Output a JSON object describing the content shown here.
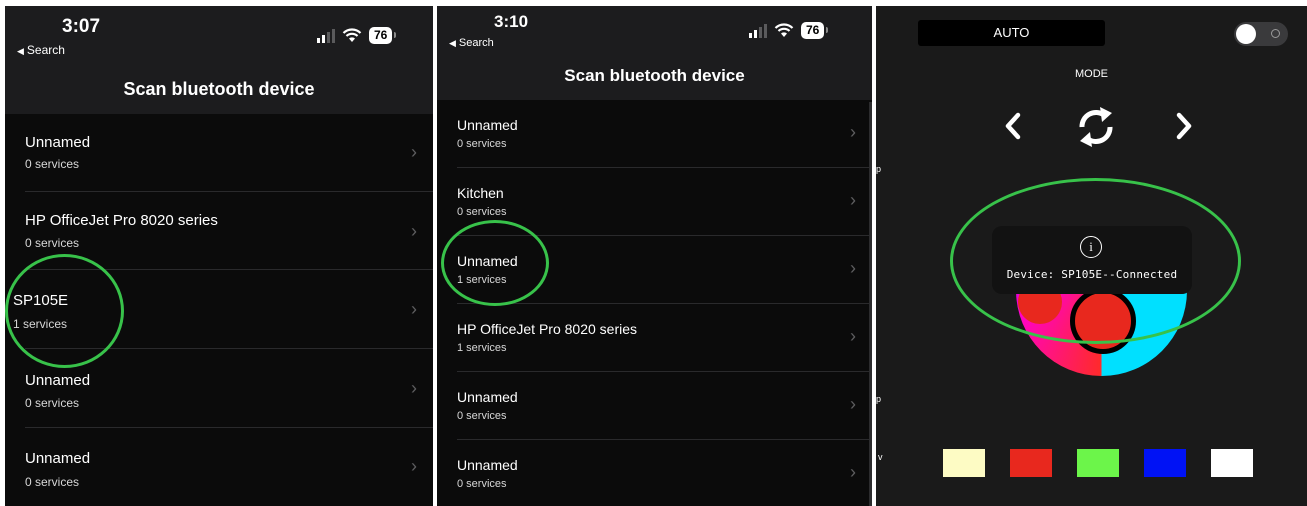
{
  "panel1": {
    "status": {
      "time": "3:07",
      "back": "Search",
      "battery": "76"
    },
    "title": "Scan bluetooth device",
    "devices": [
      {
        "name": "Unnamed",
        "services": "0 services"
      },
      {
        "name": "HP OfficeJet Pro 8020 series",
        "services": "0 services"
      },
      {
        "name": "SP105E",
        "services": "1 services"
      },
      {
        "name": "Unnamed",
        "services": "0 services"
      },
      {
        "name": "Unnamed",
        "services": "0 services"
      }
    ]
  },
  "panel2": {
    "status": {
      "time": "3:10",
      "back": "Search",
      "battery": "76"
    },
    "title": "Scan bluetooth device",
    "devices": [
      {
        "name": "Unnamed",
        "services": "0 services"
      },
      {
        "name": "Kitchen",
        "services": "0 services"
      },
      {
        "name": "Unnamed",
        "services": "1 services"
      },
      {
        "name": "HP OfficeJet Pro 8020 series",
        "services": "1 services"
      },
      {
        "name": "Unnamed",
        "services": "0 services"
      },
      {
        "name": "Unnamed",
        "services": "0 services"
      }
    ]
  },
  "panel3": {
    "auto_label": "AUTO",
    "mode_label": "MODE",
    "toast_message": "Device: SP105E--Connected",
    "swatches": [
      "#fdfbc4",
      "#e8281e",
      "#6cf54a",
      "#0012f5",
      "#ffffff"
    ],
    "stray_letters": [
      "p",
      "p",
      "v"
    ]
  },
  "colors": {
    "highlight": "#38c24a",
    "background": "#000000",
    "accent_red": "#e8281e"
  }
}
